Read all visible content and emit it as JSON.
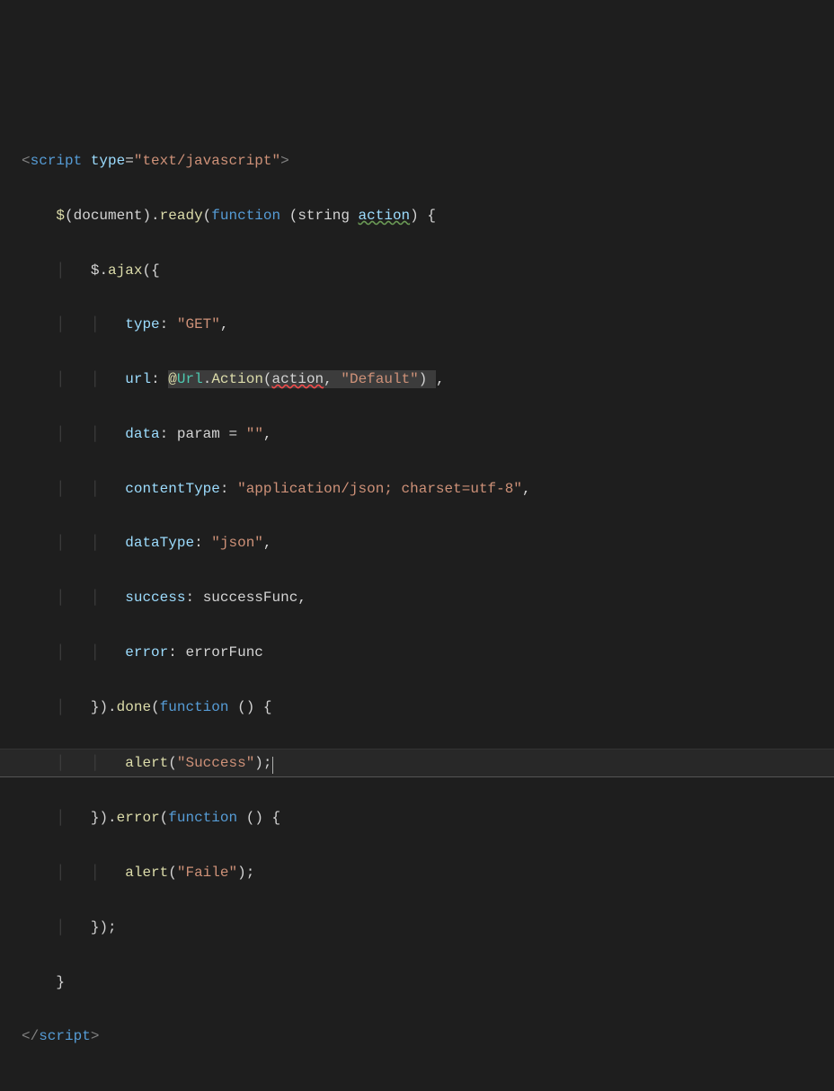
{
  "code": {
    "tag_open": "<",
    "tag_close": ">",
    "end_tag_open": "</",
    "script_tag": "script",
    "type_attr": "type",
    "eq": "=",
    "type_val": "\"text/javascript\"",
    "dollar": "$",
    "document_word": "document",
    "ready_word": "ready",
    "function_kw": "function",
    "string_kw": "string",
    "action_param": "action",
    "ajax_word": "ajax",
    "type_prop": "type",
    "get_val": "\"GET\"",
    "url_prop": "url",
    "at": "@",
    "url_ns": "Url",
    "action_method": "Action",
    "default_str": "\"Default\"",
    "data_prop": "data",
    "param_ident": "param",
    "empty_str": "\"\"",
    "contentType_prop": "contentType",
    "contentType_val": "\"application/json; charset=utf-8\"",
    "dataType_prop": "dataType",
    "json_val": "\"json\"",
    "success_prop": "success",
    "successFunc": "successFunc",
    "error_prop": "error",
    "errorFunc": "errorFunc",
    "done_word": "done",
    "alert_word": "alert",
    "success_str": "\"Success\"",
    "error_word": "error",
    "faile_str": "\"Faile\"",
    "lparen": "(",
    "rparen": ")",
    "lbrace": "{",
    "rbrace": "}",
    "dot": ".",
    "comma": ",",
    "semi": ";",
    "colon": ":",
    "space": " ",
    "guide": "│"
  }
}
